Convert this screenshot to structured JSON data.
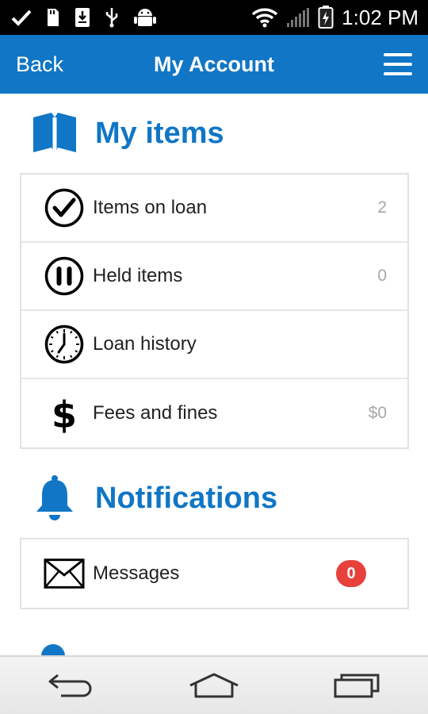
{
  "status_bar": {
    "time": "1:02 PM",
    "icons": [
      "check-icon",
      "sd-card-icon",
      "download-icon",
      "usb-icon",
      "android-icon",
      "wifi-icon",
      "signal-icon",
      "battery-icon"
    ]
  },
  "header": {
    "back_label": "Back",
    "title": "My Account",
    "menu_icon": "hamburger-menu-icon"
  },
  "my_items": {
    "title": "My items",
    "icon": "book-icon",
    "rows": [
      {
        "label": "Items on loan",
        "value": "2",
        "icon": "checkmark-circle-icon"
      },
      {
        "label": "Held items",
        "value": "0",
        "icon": "pause-circle-icon"
      },
      {
        "label": "Loan history",
        "value": "",
        "icon": "clock-icon"
      },
      {
        "label": "Fees and fines",
        "value": "$0",
        "icon": "dollar-icon"
      }
    ]
  },
  "notifications": {
    "title": "Notifications",
    "icon": "bell-icon",
    "rows": [
      {
        "label": "Messages",
        "badge": "0",
        "icon": "envelope-icon"
      }
    ]
  },
  "nav_bar": {
    "buttons": [
      "back-nav-icon",
      "home-nav-icon",
      "recent-apps-icon"
    ]
  },
  "colors": {
    "brand_blue": "#1076c5",
    "badge_red": "#e8403a",
    "value_gray": "#a8a8a8"
  }
}
